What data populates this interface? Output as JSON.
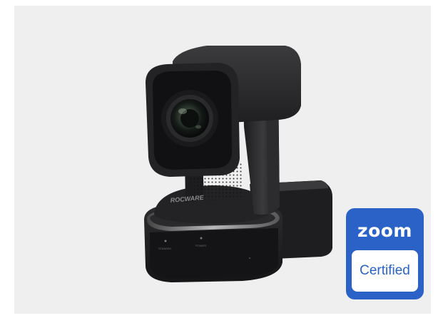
{
  "product": {
    "brand_mark": "ROCWARE",
    "indicator_labels": [
      "STANDBY",
      "POWER"
    ]
  },
  "badge": {
    "brand": "zoom",
    "label": "Certified"
  },
  "colors": {
    "background": "#efefef",
    "badge_blue": "#2b62c8",
    "camera_body": "#2a2a2c"
  }
}
